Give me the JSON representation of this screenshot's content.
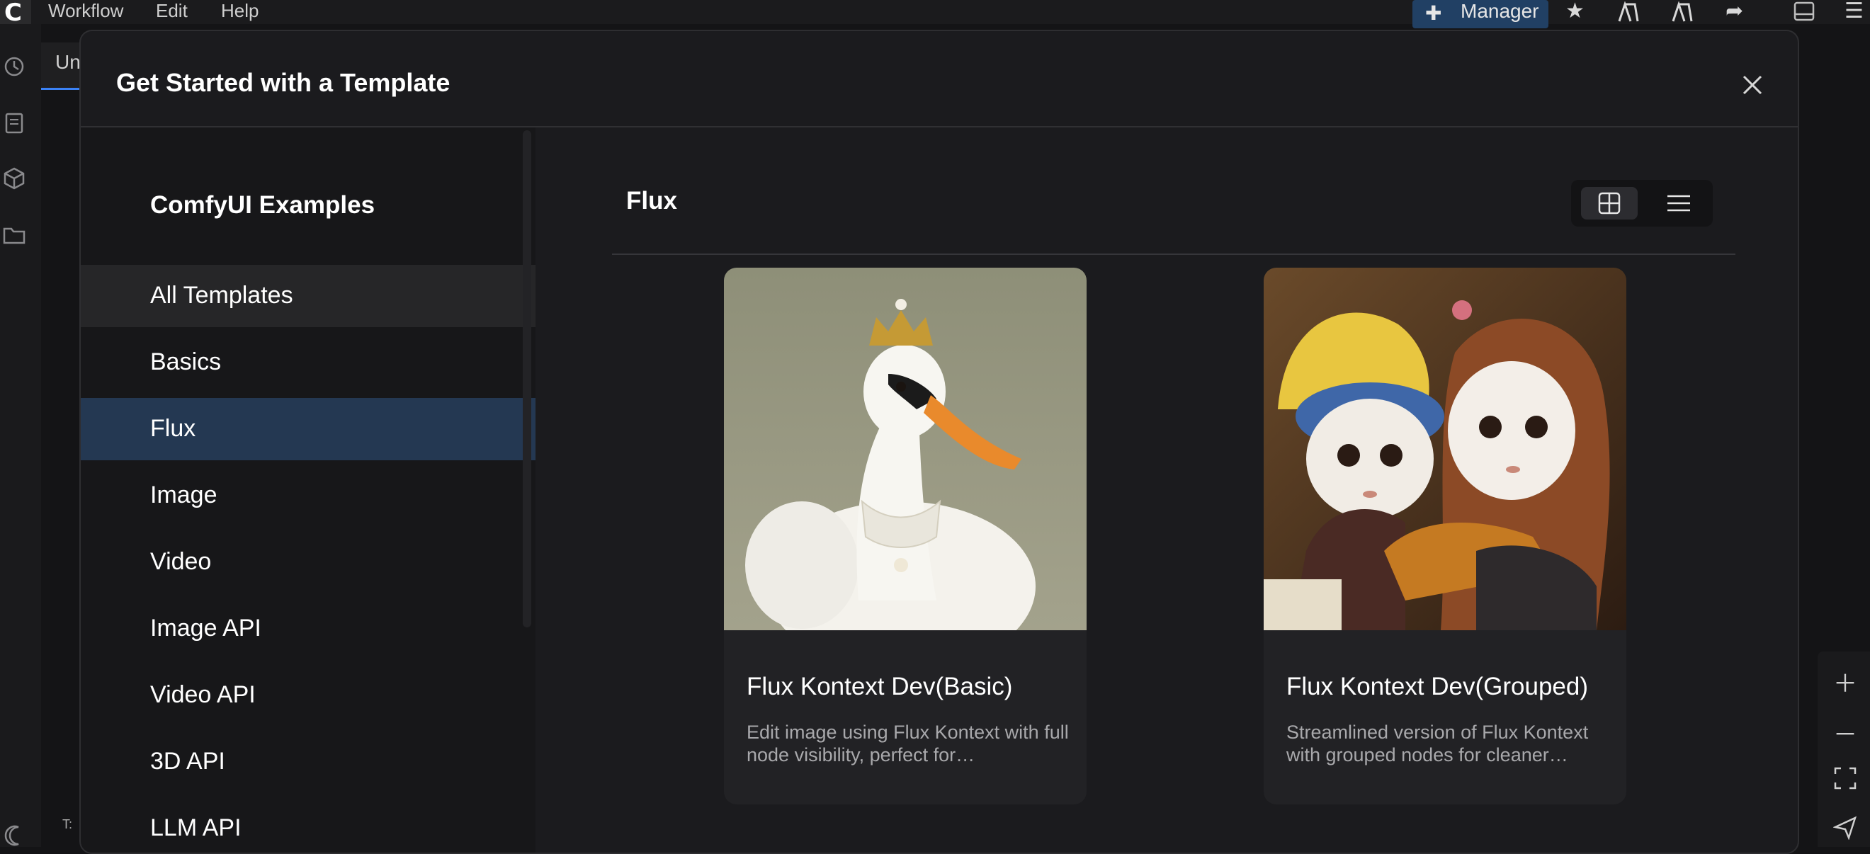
{
  "menubar": {
    "items": [
      "Workflow",
      "Edit",
      "Help"
    ],
    "manager_label": "Manager"
  },
  "background": {
    "tab_label": "Un",
    "bottom_text": "T:"
  },
  "modal": {
    "title": "Get Started with a Template",
    "sidebar": {
      "title": "ComfyUI Examples",
      "items": [
        {
          "label": "All Templates",
          "state": "hover"
        },
        {
          "label": "Basics",
          "state": "normal"
        },
        {
          "label": "Flux",
          "state": "active"
        },
        {
          "label": "Image",
          "state": "normal"
        },
        {
          "label": "Video",
          "state": "normal"
        },
        {
          "label": "Image API",
          "state": "normal"
        },
        {
          "label": "Video API",
          "state": "normal"
        },
        {
          "label": "3D API",
          "state": "normal"
        },
        {
          "label": "LLM API",
          "state": "normal"
        }
      ]
    },
    "content": {
      "category_title": "Flux",
      "view_mode": "grid",
      "cards": [
        {
          "title": "Flux Kontext Dev(Basic)",
          "description": "Edit image using Flux Kontext with full node visibility, perfect for…",
          "image": "swan-with-crown"
        },
        {
          "title": "Flux Kontext Dev(Grouped)",
          "description": "Streamlined version of Flux Kontext with grouped nodes for cleaner…",
          "image": "two-felt-dolls-hugging"
        }
      ]
    }
  },
  "colors": {
    "accent": "#3b82f6",
    "active_nav": "#243852",
    "manager_bg": "#214064"
  }
}
